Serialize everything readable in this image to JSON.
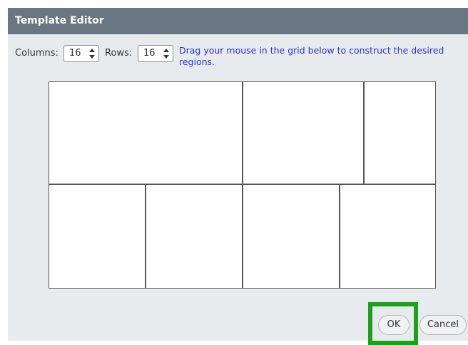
{
  "dialog": {
    "title": "Template Editor",
    "columns_label": "Columns:",
    "columns_value": "16",
    "rows_label": "Rows:",
    "rows_value": "16",
    "instruction": "Drag your mouse in the grid below to construct the desired regions.",
    "ok_label": "OK",
    "cancel_label": "Cancel",
    "grid": {
      "columns": 16,
      "rows": 16,
      "regions_top_row": 3,
      "regions_bottom_row": 4
    }
  }
}
